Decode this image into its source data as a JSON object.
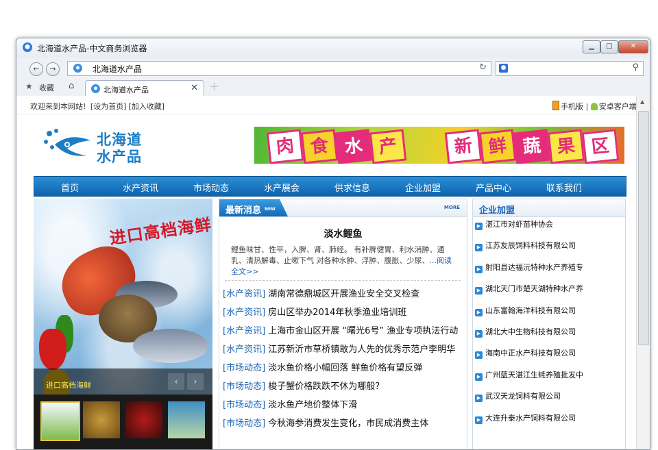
{
  "browser": {
    "window_title": "北海道水产品-中文商务浏览器",
    "address_url": "北海道水产品",
    "tab_label": "北海道水产品",
    "favorites_label": "收藏",
    "favbar_left": [
      "欢迎来到本网站!",
      "[设为首页]",
      "[加入收藏]"
    ],
    "favbar_right": [
      "手机版",
      "|",
      "安卓客户端",
      "|"
    ]
  },
  "site": {
    "logo_line1": "北海道",
    "logo_line2": "水产品",
    "banner_chars": [
      "肉",
      "食",
      "水",
      "产",
      "新",
      "鲜",
      "蔬",
      "果",
      "区"
    ],
    "nav": [
      "首页",
      "水产资讯",
      "市场动态",
      "水产展会",
      "供求信息",
      "企业加盟",
      "产品中心",
      "联系我们"
    ]
  },
  "slideshow": {
    "headline": "进口高档海鲜",
    "caption": "进口高档海鲜",
    "prev": "‹",
    "next": "›"
  },
  "news": {
    "title": "最新消息",
    "title_tag": "NEW",
    "more": "MORE",
    "featured_title": "淡水鲤鱼",
    "featured_desc": "鲤鱼味甘、性平，入脾、肾、肺经。 有补脾健胃、利水消肿、通乳、清热解毒、止嗽下气 对各种水肿、浮肿、腹胀、少尿、",
    "read_all": "...阅读全文>>",
    "items": [
      {
        "cat": "[水产资讯]",
        "text": "湖南常德鼎城区开展渔业安全交叉检查"
      },
      {
        "cat": "[水产资讯]",
        "text": "房山区举办2014年秋季渔业培训班"
      },
      {
        "cat": "[水产资讯]",
        "text": "上海市金山区开展 “曙光6号” 渔业专项执法行动"
      },
      {
        "cat": "[水产资讯]",
        "text": "江苏新沂市草桥镇敢为人先的优秀示范户李明华"
      },
      {
        "cat": "[市场动态]",
        "text": "淡水鱼价格小幅回落 鲜鱼价格有望反弹"
      },
      {
        "cat": "[市场动态]",
        "text": "梭子蟹价格跌跌不休为哪般？"
      },
      {
        "cat": "[市场动态]",
        "text": "淡水鱼产地价整体下滑"
      },
      {
        "cat": "[市场动态]",
        "text": "今秋海参消费发生变化，市民成消费主体"
      }
    ]
  },
  "enterprise": {
    "title": "企业加盟",
    "items": [
      "湛江市对虾苗种协会",
      "江苏友辰饲料科技有限公司",
      "射阳县达福沅特种水产养殖专",
      "湖北天门市楚天湖特种水产养",
      "山东富翰海洋科技有限公司",
      "湖北大中生物科技有限公司",
      "海南中正水产科技有限公司",
      "广州蓝天湛江生蚝养殖批发中",
      "武汉天龙饲料有限公司",
      "大连升泰水产饲料有限公司"
    ]
  },
  "icons": {
    "ie": "ie-icon",
    "back": "back-arrow-icon",
    "forward": "forward-arrow-icon",
    "reload": "reload-icon",
    "search": "magnifier-icon",
    "star": "star-icon",
    "home": "home-icon",
    "close": "close-icon",
    "new_tab": "plus-icon",
    "phone": "phone-icon",
    "android": "android-icon"
  },
  "colors": {
    "nav_bg": "#1570bd",
    "brand_blue": "#1b7ec5",
    "link_blue": "#1a63b5",
    "headline_red": "#d3182a"
  }
}
